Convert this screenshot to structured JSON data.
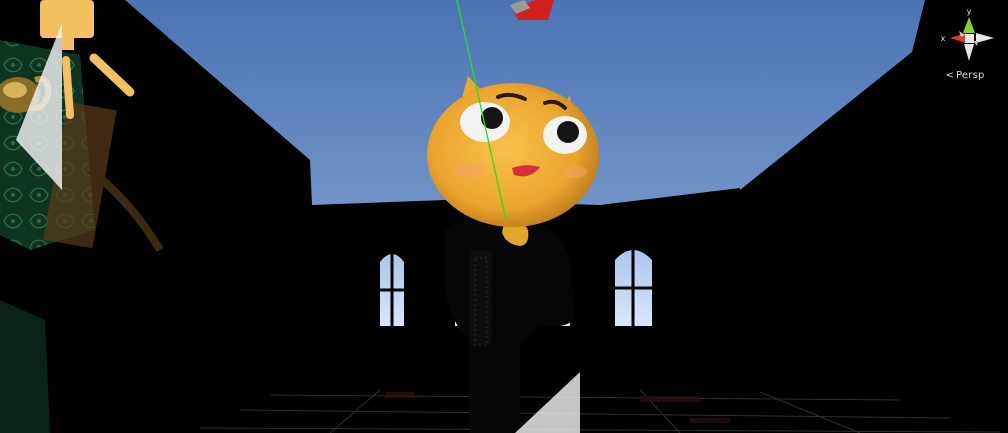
{
  "scene_view": {
    "gizmo": {
      "axis_y_label": "y",
      "axis_x_label": "x",
      "projection_label": "Persp",
      "projection_icon": "perspective-glyph"
    }
  },
  "colors": {
    "sky_top": "#4a74b4",
    "sky_bottom": "#8fb0dc",
    "character_head": "#f0b13a",
    "character_mouth": "#e0313a",
    "light_gizmo": "#f5c060",
    "green_ray": "#23e31a",
    "room_wall": "#000000",
    "wallpaper": "#0e3a22",
    "gizmo_x_axis": "#e03a2a",
    "gizmo_y_axis": "#8ad12a",
    "gizmo_center": "#e8e8e8"
  }
}
